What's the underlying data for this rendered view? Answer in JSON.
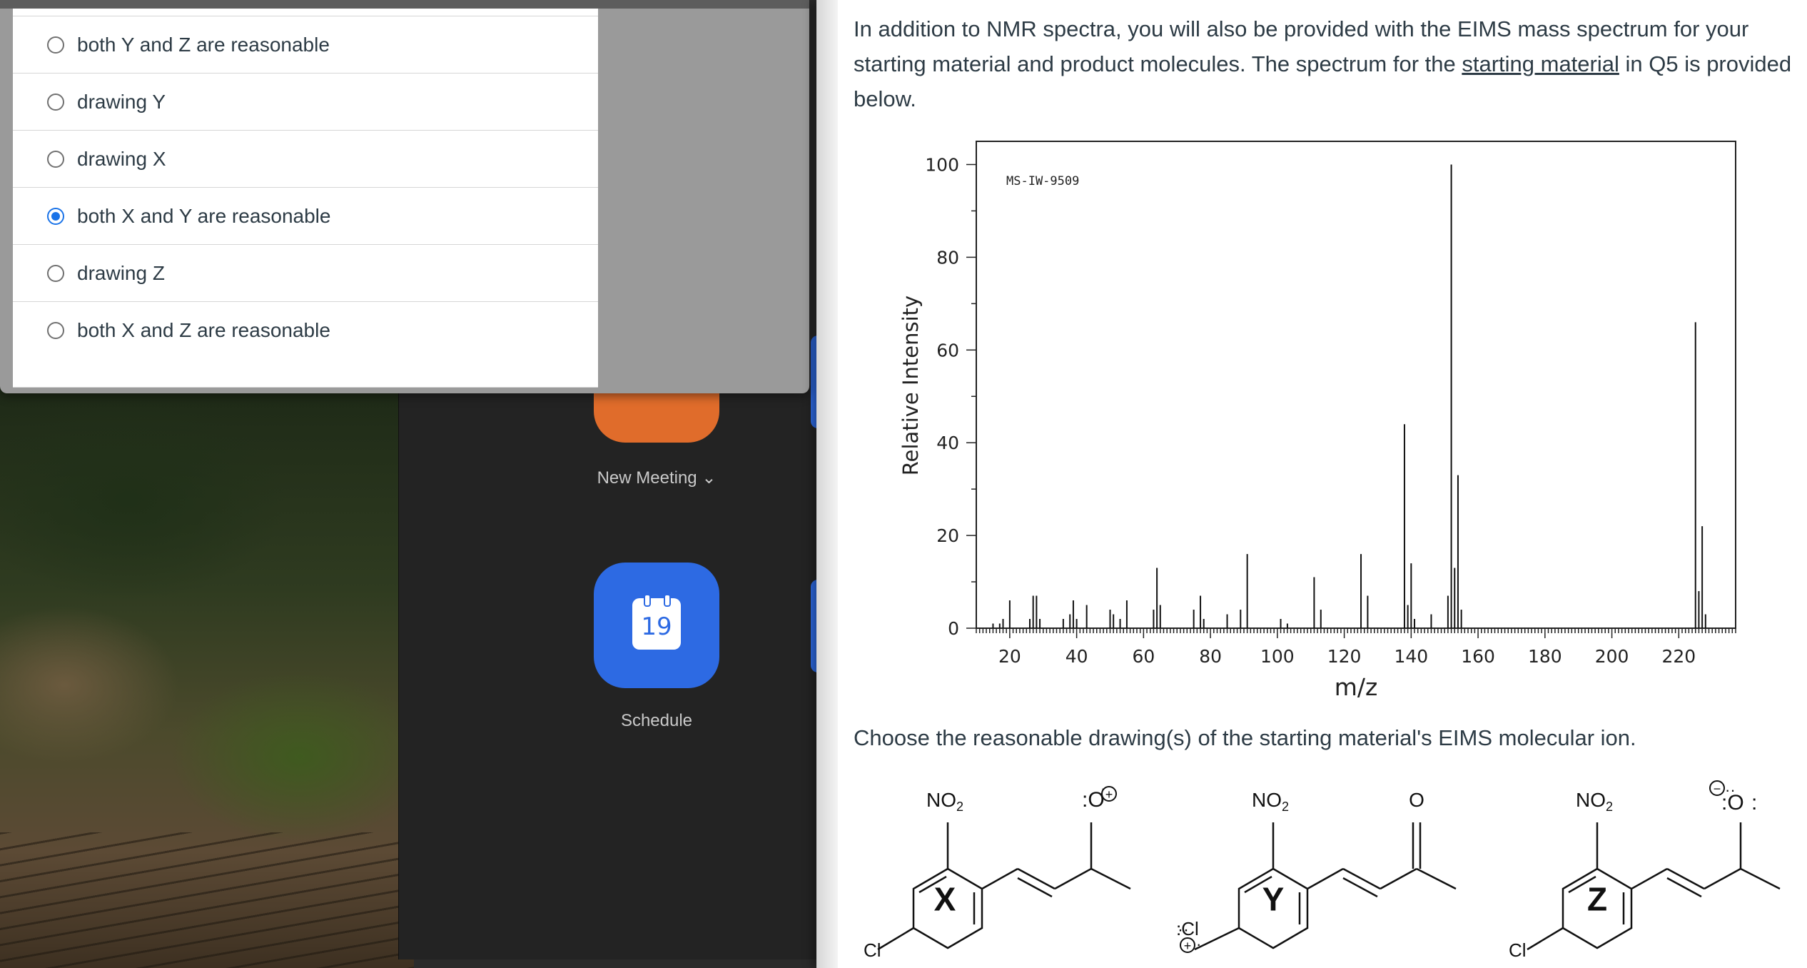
{
  "options": [
    {
      "label": "both Y and Z are reasonable",
      "selected": false
    },
    {
      "label": "drawing Y",
      "selected": false
    },
    {
      "label": "drawing X",
      "selected": false
    },
    {
      "label": "both X and Y are reasonable",
      "selected": true
    },
    {
      "label": "drawing Z",
      "selected": false
    },
    {
      "label": "both X and Z are reasonable",
      "selected": false
    }
  ],
  "app": {
    "new_meeting_label": "New Meeting",
    "chevron": "⌄",
    "schedule_label": "Schedule",
    "calendar_day": "19"
  },
  "question": {
    "intro_1": "In addition to NMR spectra, you will also be provided with the EIMS mass spectrum for your starting material and product molecules. The spectrum for the ",
    "intro_link": "starting material",
    "intro_2": " in Q5 is provided below.",
    "prompt": "Choose the reasonable drawing(s) of the starting material's EIMS molecular ion."
  },
  "chart_data": {
    "type": "bar",
    "title": "MS-IW-9509",
    "xlabel": "m/z",
    "ylabel": "Relative Intensity",
    "xlim": [
      10,
      237
    ],
    "ylim": [
      0,
      105
    ],
    "xticks": [
      20,
      40,
      60,
      80,
      100,
      120,
      140,
      160,
      180,
      200,
      220
    ],
    "yticks": [
      0,
      20,
      40,
      60,
      80,
      100
    ],
    "peaks": [
      {
        "mz": 15,
        "intensity": 1
      },
      {
        "mz": 17,
        "intensity": 1
      },
      {
        "mz": 18,
        "intensity": 2
      },
      {
        "mz": 20,
        "intensity": 6
      },
      {
        "mz": 26,
        "intensity": 2
      },
      {
        "mz": 27,
        "intensity": 7
      },
      {
        "mz": 28,
        "intensity": 7
      },
      {
        "mz": 29,
        "intensity": 2
      },
      {
        "mz": 36,
        "intensity": 2
      },
      {
        "mz": 38,
        "intensity": 3
      },
      {
        "mz": 39,
        "intensity": 6
      },
      {
        "mz": 40,
        "intensity": 2
      },
      {
        "mz": 43,
        "intensity": 5
      },
      {
        "mz": 50,
        "intensity": 4
      },
      {
        "mz": 51,
        "intensity": 3
      },
      {
        "mz": 53,
        "intensity": 2
      },
      {
        "mz": 55,
        "intensity": 6
      },
      {
        "mz": 63,
        "intensity": 4
      },
      {
        "mz": 64,
        "intensity": 13
      },
      {
        "mz": 65,
        "intensity": 5
      },
      {
        "mz": 75,
        "intensity": 4
      },
      {
        "mz": 77,
        "intensity": 7
      },
      {
        "mz": 78,
        "intensity": 2
      },
      {
        "mz": 85,
        "intensity": 3
      },
      {
        "mz": 89,
        "intensity": 4
      },
      {
        "mz": 91,
        "intensity": 16
      },
      {
        "mz": 101,
        "intensity": 2
      },
      {
        "mz": 103,
        "intensity": 1
      },
      {
        "mz": 111,
        "intensity": 11
      },
      {
        "mz": 113,
        "intensity": 4
      },
      {
        "mz": 125,
        "intensity": 16
      },
      {
        "mz": 127,
        "intensity": 7
      },
      {
        "mz": 138,
        "intensity": 44
      },
      {
        "mz": 139,
        "intensity": 5
      },
      {
        "mz": 140,
        "intensity": 14
      },
      {
        "mz": 141,
        "intensity": 2
      },
      {
        "mz": 146,
        "intensity": 3
      },
      {
        "mz": 151,
        "intensity": 7
      },
      {
        "mz": 152,
        "intensity": 100
      },
      {
        "mz": 153,
        "intensity": 13
      },
      {
        "mz": 154,
        "intensity": 33
      },
      {
        "mz": 155,
        "intensity": 4
      },
      {
        "mz": 225,
        "intensity": 66
      },
      {
        "mz": 226,
        "intensity": 8
      },
      {
        "mz": 227,
        "intensity": 22
      },
      {
        "mz": 228,
        "intensity": 3
      }
    ]
  },
  "molecules": {
    "no2": "NO",
    "no2_sub": "2",
    "cl": "Cl",
    "cl_lp": ":Cl",
    "o": "O",
    "o_lp": ":O",
    "plus": "+",
    "minus": "−",
    "x": "X",
    "y": "Y",
    "z": "Z",
    "lp_dots": "··",
    "colon": ":",
    "dot": "·"
  }
}
